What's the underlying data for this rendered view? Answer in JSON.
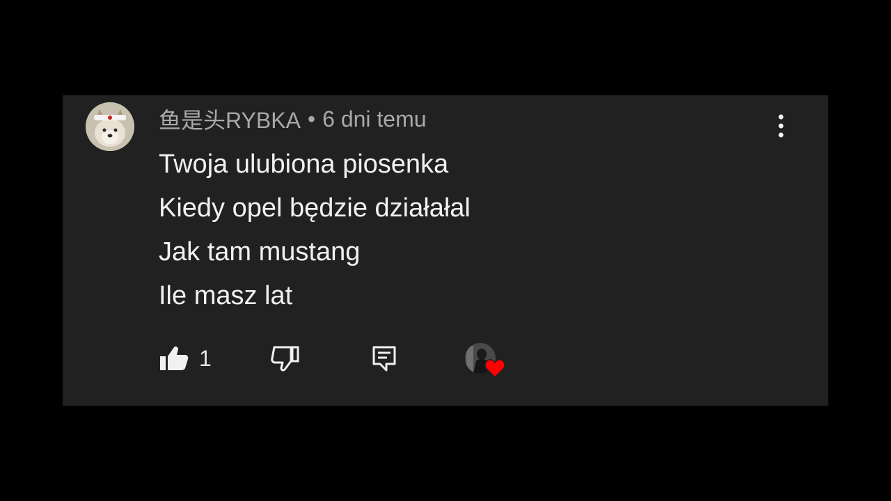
{
  "comment": {
    "author": "鱼是头RYBKA",
    "separator": "•",
    "time": "6 dni temu",
    "lines": [
      "Twoja ulubiona piosenka",
      "Kiedy opel będzie działałal",
      "Jak tam mustang",
      "Ile masz lat"
    ],
    "like_count": "1"
  },
  "icons": {
    "menu": "more-vert-icon",
    "like": "thumb-up-icon",
    "dislike": "thumb-down-icon",
    "reply": "reply-icon",
    "heart": "creator-heart-icon"
  },
  "colors": {
    "background": "#000000",
    "card": "#212121",
    "text": "#f1f1f1",
    "meta": "#a9a9a9",
    "heart": "#ff0000"
  }
}
